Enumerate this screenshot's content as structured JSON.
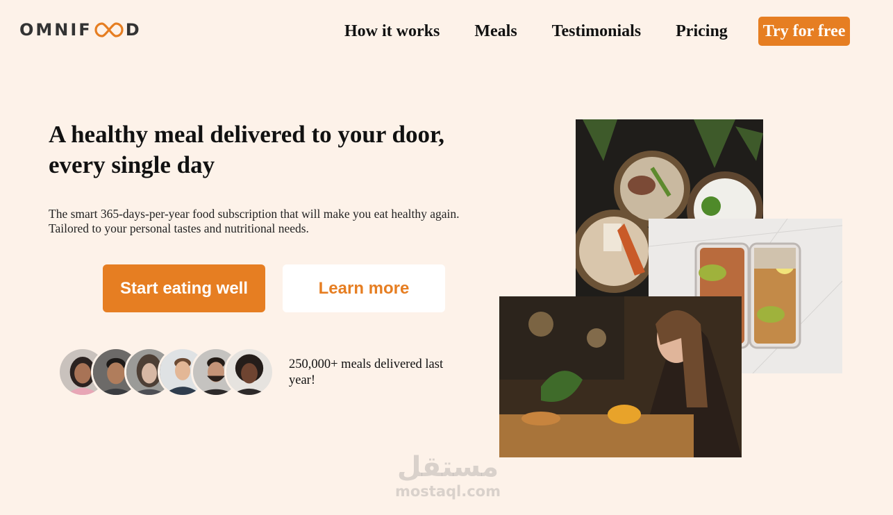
{
  "header": {
    "logo_left": "OMNIF",
    "logo_right": "D",
    "logo_mark": "infinity-icon",
    "nav": [
      "How it works",
      "Meals",
      "Testimonials",
      "Pricing"
    ],
    "cta": "Try for free"
  },
  "hero": {
    "title_line1": "A healthy meal delivered to your door,",
    "title_line2": "every single day",
    "desc_line1": "The smart 365-days-per-year food subscription that will make you eat healthy again.",
    "desc_line2": "Tailored to your personal tastes and nutritional needs.",
    "primary_button": "Start eating well",
    "secondary_button": "Learn more"
  },
  "customers": {
    "avatar_count": 6,
    "text": "250,000+ meals delivered last year!"
  },
  "watermark": {
    "arabic": "مستقل",
    "latin": "mostaql.com"
  },
  "colors": {
    "background": "#fdf2e9",
    "accent": "#e67e22"
  }
}
